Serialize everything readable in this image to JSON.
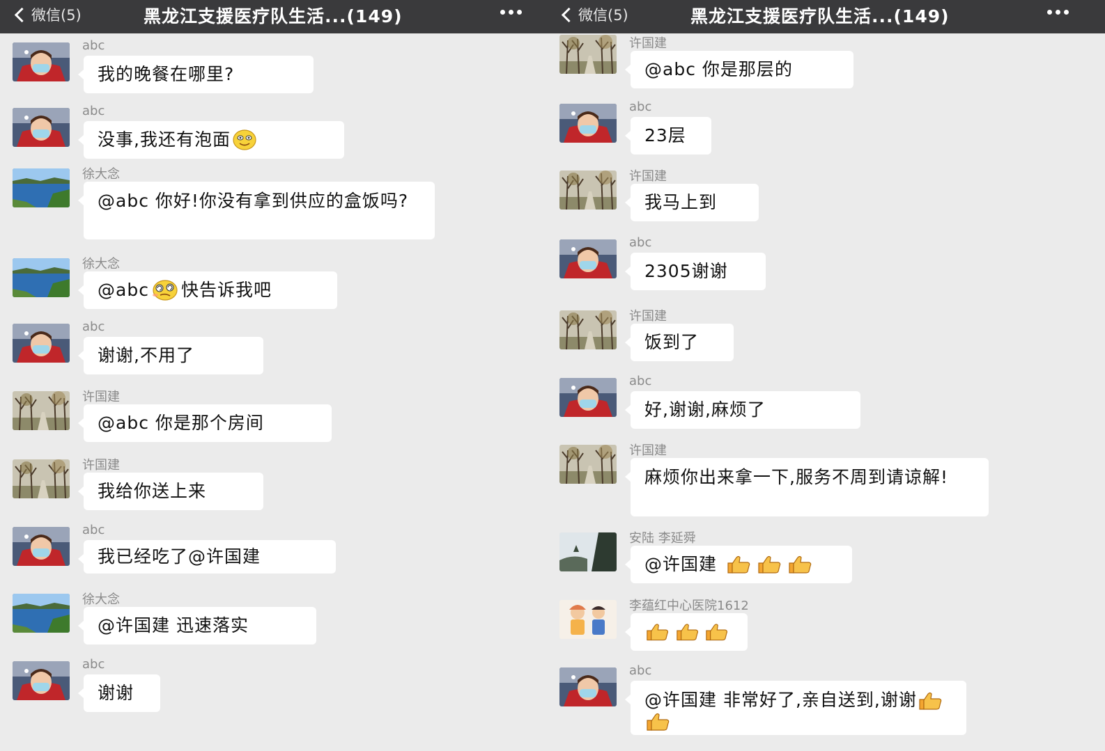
{
  "left": {
    "header": {
      "back_label": "微信(5)",
      "title": "黑龙江支援医疗队生活...(149)"
    },
    "messages": [
      {
        "sender": "abc",
        "text": "我的晚餐在哪里?"
      },
      {
        "sender": "abc",
        "text": "没事,我还有泡面",
        "emoji": "smile-emoji"
      },
      {
        "sender": "徐大念",
        "text": "@abc 你好!你没有拿到供应的盒饭吗?"
      },
      {
        "sender": "徐大念",
        "text_before": "@abc",
        "text": "快告诉我吧",
        "emoji": "dizzy-emoji"
      },
      {
        "sender": "abc",
        "text": "谢谢,不用了"
      },
      {
        "sender": "许国建",
        "text": "@abc 你是那个房间"
      },
      {
        "sender": "许国建",
        "text": "我给你送上来"
      },
      {
        "sender": "abc",
        "text": "我已经吃了@许国建"
      },
      {
        "sender": "徐大念",
        "text": "@许国建 迅速落实"
      },
      {
        "sender": "abc",
        "text": "谢谢"
      }
    ]
  },
  "right": {
    "header": {
      "back_label": "微信(5)",
      "title": "黑龙江支援医疗队生活...(149)"
    },
    "messages": [
      {
        "sender": "许国建",
        "text": "@abc 你是那层的"
      },
      {
        "sender": "abc",
        "text": "23层"
      },
      {
        "sender": "许国建",
        "text": "我马上到"
      },
      {
        "sender": "abc",
        "text": "2305谢谢"
      },
      {
        "sender": "许国建",
        "text": "饭到了"
      },
      {
        "sender": "abc",
        "text": "好,谢谢,麻烦了"
      },
      {
        "sender": "许国建",
        "text": "麻烦你出来拿一下,服务不周到请谅解!"
      },
      {
        "sender": "安陆 李延舜",
        "text": "@许国建",
        "thumbs": 3
      },
      {
        "sender": "李蕴红中心医院1612",
        "text": "",
        "thumbs": 3
      },
      {
        "sender": "abc",
        "text": "@许国建 非常好了,亲自送到,谢谢",
        "thumbs": 2
      }
    ]
  },
  "colors": {
    "header_bg": "#3a3a3c",
    "chat_bg": "#ebebeb",
    "bubble_bg": "#ffffff",
    "sender_gray": "#8a8a8a"
  },
  "icons": [
    "back-chevron-icon",
    "more-dots-icon",
    "smile-emoji",
    "dizzy-emoji",
    "thumbs-up-emoji"
  ]
}
